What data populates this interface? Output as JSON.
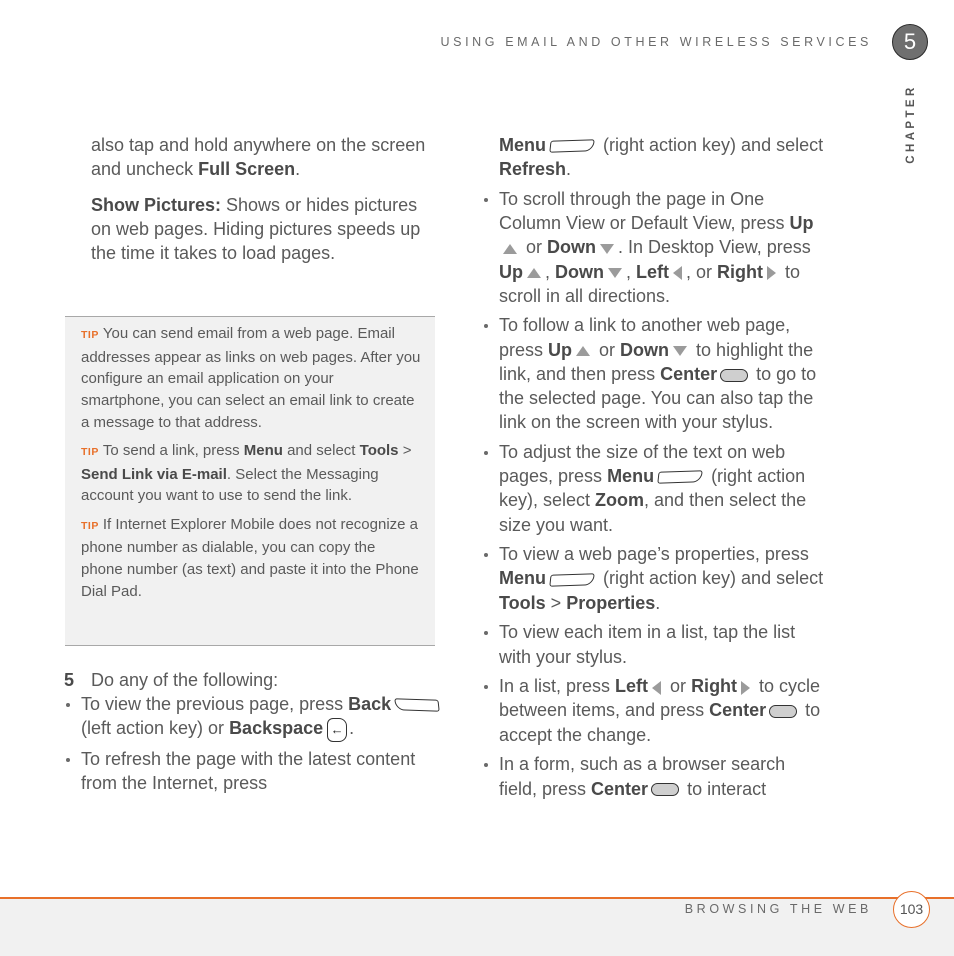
{
  "header": {
    "running_head": "USING EMAIL AND OTHER WIRELESS SERVICES",
    "chapter_number": "5",
    "chapter_label": "CHAPTER"
  },
  "left_top": {
    "p1_text": "also tap and hold anywhere on the screen and uncheck ",
    "p1_bold": "Full Screen",
    "p1_end": ".",
    "p2_bold": "Show Pictures:",
    "p2_text": " Shows or hides pictures on web pages. Hiding pictures speeds up the time it takes to load pages."
  },
  "tips": {
    "label": "TIP",
    "tip1": "You can send email from a web page. Email addresses appear as links on web pages. After you configure an email application on your smartphone, you can select an email link to create a message to that address.",
    "tip2_a": "To send a link, press ",
    "tip2_menu": "Menu",
    "tip2_b": " and select ",
    "tip2_tools": "Tools",
    "tip2_gt": " > ",
    "tip2_send": "Send Link via E-mail",
    "tip2_c": ". Select the Messaging account you want to use to send the link.",
    "tip3": "If Internet Explorer Mobile does not recognize a phone number as dialable, you can copy the phone number (as text) and paste it into the Phone Dial Pad."
  },
  "step": {
    "number": "5",
    "text": "Do any of the following:",
    "b1_a": "To view the previous page, press ",
    "b1_back": "Back",
    "b1_b": " (left action key) or ",
    "b1_backspace": "Backspace",
    "b1_c": ".",
    "b2_a": "To refresh the page with the latest content from the Internet, press"
  },
  "right": {
    "cont_menu": "Menu",
    "cont_a": " (right action key) and select ",
    "cont_refresh": "Refresh",
    "cont_end": ".",
    "b3_a": "To scroll through the page in One Column View or Default View, press ",
    "b3_up": "Up",
    "b3_or": " or ",
    "b3_down": "Down",
    "b3_b": ". In Desktop View, press ",
    "b3_up2": "Up",
    "b3_comma1": ", ",
    "b3_down2": "Down",
    "b3_comma2": ", ",
    "b3_left": "Left",
    "b3_or2": ", or ",
    "b3_right": "Right",
    "b3_c": " to scroll in all directions.",
    "b4_a": "To follow a link to another web page, press ",
    "b4_up": "Up",
    "b4_or": " or ",
    "b4_down": "Down",
    "b4_b": " to highlight the link, and then press ",
    "b4_center": "Center",
    "b4_c": " to go to the selected page. You can also tap the link on the screen with your stylus.",
    "b5_a": "To adjust the size of the text on web pages, press ",
    "b5_menu": "Menu",
    "b5_b": " (right action key), select ",
    "b5_zoom": "Zoom",
    "b5_c": ", and then select the size you want.",
    "b6_a": "To view a web page’s properties, press ",
    "b6_menu": "Menu",
    "b6_b": " (right action key) and select ",
    "b6_tools": "Tools",
    "b6_gt": " > ",
    "b6_props": "Properties",
    "b6_c": ".",
    "b7": "To view each item in a list, tap the list with your stylus.",
    "b8_a": "In a list, press ",
    "b8_left": "Left",
    "b8_or": " or ",
    "b8_right": "Right",
    "b8_b": " to cycle between items, and press ",
    "b8_center": "Center",
    "b8_c": " to accept the change.",
    "b9_a": "In a form, such as a browser search field, press ",
    "b9_center": "Center",
    "b9_b": " to interact"
  },
  "footer": {
    "section": "BROWSING THE WEB",
    "page_number": "103"
  },
  "colors": {
    "accent": "#e8702a",
    "text": "#5a5a5a",
    "tip_bg": "#f1f1f1",
    "chapter_circle": "#6f6f6f"
  }
}
